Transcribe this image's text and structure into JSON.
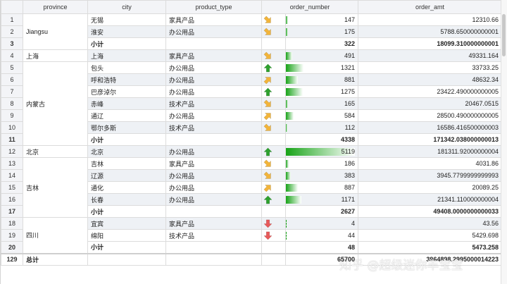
{
  "headers": {
    "province": "province",
    "city": "city",
    "product_type": "product_type",
    "order_number": "order_number",
    "order_amt": "order_amt"
  },
  "colors": {
    "bar": "#17a317",
    "up": "#2ea12e",
    "down": "#e85a5a",
    "diag": "#f2b43a"
  },
  "rows": [
    {
      "rn": "1",
      "prov": "",
      "city": "无锡",
      "ptype": "家具产品",
      "icon": "down-right",
      "num": "147",
      "amt": "12310.66",
      "bar": 0.029
    },
    {
      "rn": "2",
      "prov": "Jiangsu",
      "city": "淮安",
      "ptype": "办公用品",
      "icon": "down-right",
      "num": "175",
      "amt": "5788.650000000001",
      "bar": 0.034
    },
    {
      "rn": "3",
      "prov": "",
      "city": "小计",
      "ptype": "",
      "icon": "",
      "num": "322",
      "amt": "18099.310000000001",
      "bar": 0,
      "sub": true
    },
    {
      "rn": "4",
      "prov": "上海",
      "city": "上海",
      "ptype": "家具产品",
      "icon": "down-right",
      "num": "491",
      "amt": "49331.164",
      "bar": 0.096
    },
    {
      "rn": "5",
      "prov": "",
      "city": "包头",
      "ptype": "办公用品",
      "icon": "up",
      "num": "1321",
      "amt": "33733.25",
      "bar": 0.258
    },
    {
      "rn": "6",
      "prov": "",
      "city": "呼和浩特",
      "ptype": "办公用品",
      "icon": "up-right",
      "num": "881",
      "amt": "48632.34",
      "bar": 0.172
    },
    {
      "rn": "7",
      "prov": "",
      "city": "巴彦淖尔",
      "ptype": "办公用品",
      "icon": "up",
      "num": "1275",
      "amt": "23422.490000000005",
      "bar": 0.249
    },
    {
      "rn": "8",
      "prov": "内蒙古",
      "city": "赤峰",
      "ptype": "技术产品",
      "icon": "down-right",
      "num": "165",
      "amt": "20467.0515",
      "bar": 0.032
    },
    {
      "rn": "9",
      "prov": "",
      "city": "通辽",
      "ptype": "办公用品",
      "icon": "up-right",
      "num": "584",
      "amt": "28500.490000000005",
      "bar": 0.114
    },
    {
      "rn": "10",
      "prov": "",
      "city": "鄂尔多斯",
      "ptype": "技术产品",
      "icon": "down-right",
      "num": "112",
      "amt": "16586.416500000003",
      "bar": 0.022
    },
    {
      "rn": "11",
      "prov": "",
      "city": "小计",
      "ptype": "",
      "icon": "",
      "num": "4338",
      "amt": "171342.038000000013",
      "bar": 0,
      "sub": true
    },
    {
      "rn": "12",
      "prov": "北京",
      "city": "北京",
      "ptype": "办公用品",
      "icon": "up",
      "num": "5119",
      "amt": "181311.92000000004",
      "bar": 1.0
    },
    {
      "rn": "13",
      "prov": "",
      "city": "吉林",
      "ptype": "家具产品",
      "icon": "down-right",
      "num": "186",
      "amt": "4031.86",
      "bar": 0.036
    },
    {
      "rn": "14",
      "prov": "",
      "city": "辽源",
      "ptype": "办公用品",
      "icon": "down-right",
      "num": "383",
      "amt": "3945.7799999999993",
      "bar": 0.075
    },
    {
      "rn": "15",
      "prov": "吉林",
      "city": "通化",
      "ptype": "办公用品",
      "icon": "up-right",
      "num": "887",
      "amt": "20089.25",
      "bar": 0.173
    },
    {
      "rn": "16",
      "prov": "",
      "city": "长春",
      "ptype": "办公用品",
      "icon": "up",
      "num": "1171",
      "amt": "21341.110000000004",
      "bar": 0.229
    },
    {
      "rn": "17",
      "prov": "",
      "city": "小计",
      "ptype": "",
      "icon": "",
      "num": "2627",
      "amt": "49408.0000000000033",
      "bar": 0,
      "sub": true
    },
    {
      "rn": "18",
      "prov": "",
      "city": "宜宾",
      "ptype": "家具产品",
      "icon": "down",
      "num": "4",
      "amt": "43.56",
      "bar": 0.001
    },
    {
      "rn": "19",
      "prov": "四川",
      "city": "绵阳",
      "ptype": "技术产品",
      "icon": "down",
      "num": "44",
      "amt": "5429.698",
      "bar": 0.009
    },
    {
      "rn": "20",
      "prov": "",
      "city": "小计",
      "ptype": "",
      "icon": "",
      "num": "48",
      "amt": "5473.258",
      "bar": 0,
      "sub": true
    },
    {
      "rn": "129",
      "prov": "总计",
      "city": "",
      "ptype": "",
      "icon": "",
      "num": "65700",
      "amt": "3964898.2995000014223",
      "bar": 0,
      "total": true
    }
  ],
  "watermark": "知乎 @超级迷你丰宝宝"
}
